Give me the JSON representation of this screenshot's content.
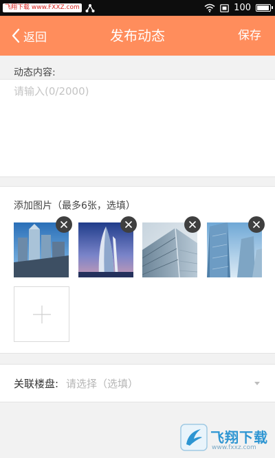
{
  "status_bar": {
    "watermark_text": "飞翔下载 www.FXXZ.com",
    "battery": "100",
    "battery_level": 1.0,
    "icons": [
      "share-icon",
      "wifi-icon",
      "sim-icon",
      "battery-icon"
    ]
  },
  "header": {
    "back_label": "返回",
    "title": "发布动态",
    "save_label": "保存",
    "background_color": "#ff8d5c"
  },
  "content": {
    "label": "动态内容:",
    "placeholder": "请输入(0/2000)",
    "value": ""
  },
  "images": {
    "label": "添加图片（最多6张，选填）",
    "items": [
      {
        "name": "building-photo-1"
      },
      {
        "name": "building-photo-2"
      },
      {
        "name": "building-photo-3"
      },
      {
        "name": "building-photo-4"
      }
    ],
    "remove_icon": "close-icon",
    "add_icon": "plus-icon"
  },
  "property": {
    "label": "关联楼盘:",
    "placeholder": "请选择（选填）",
    "arrow_icon": "dropdown-arrow-icon"
  },
  "site_logo": {
    "text": "飞翔下载",
    "url": "www.fxxz.com"
  }
}
